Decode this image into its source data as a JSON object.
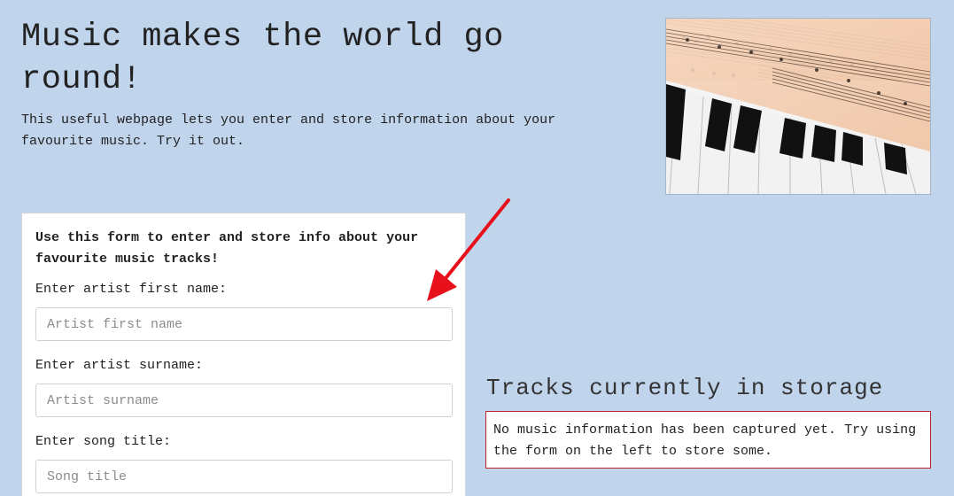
{
  "header": {
    "title": "Music makes the world go round!",
    "intro": "This useful webpage lets you enter and store information about your favourite music. Try it out."
  },
  "hero_image": {
    "icon": "sheet-music-piano-image"
  },
  "form": {
    "intro": "Use this form to enter and store info about your favourite music tracks!",
    "fields": [
      {
        "label": "Enter artist first name:",
        "placeholder": "Artist first name",
        "value": ""
      },
      {
        "label": "Enter artist surname:",
        "placeholder": "Artist surname",
        "value": ""
      },
      {
        "label": "Enter song title:",
        "placeholder": "Song title",
        "value": ""
      }
    ]
  },
  "annotation": {
    "icon": "red-arrow-icon",
    "color": "#e8111b"
  },
  "storage": {
    "heading": "Tracks currently in storage",
    "empty_message": "No music information has been captured yet. Try using the form on the left to store some.",
    "border_color": "#c0202a"
  }
}
